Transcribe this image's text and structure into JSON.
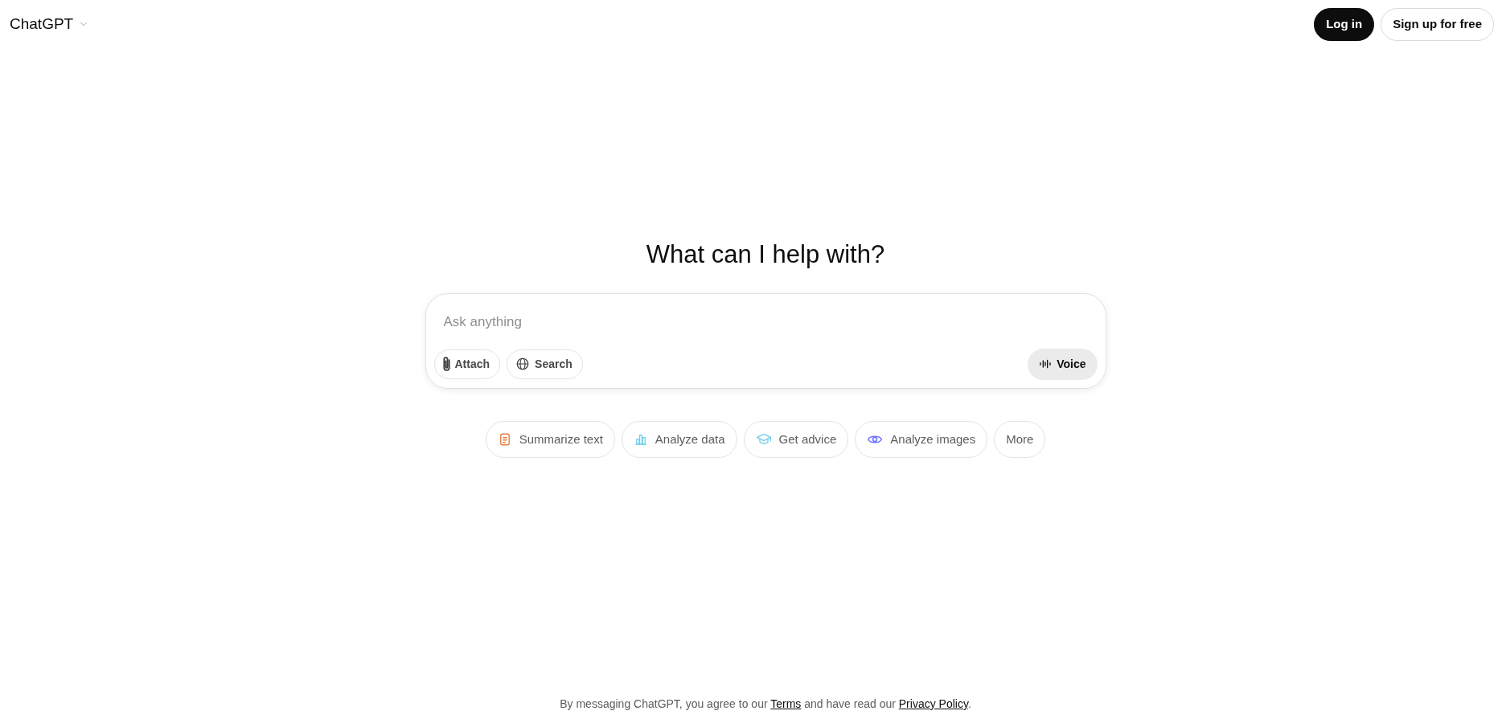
{
  "header": {
    "title": "ChatGPT",
    "buttons": [
      {
        "label": "Log in",
        "kind": "primary"
      },
      {
        "label": "Sign up for free",
        "kind": "outline"
      }
    ]
  },
  "heading": "What can I help with?",
  "composer": {
    "placeholder": "Ask anything",
    "tools": [
      {
        "label": "Attach",
        "kind": "attach"
      },
      {
        "label": "Search",
        "kind": "globe"
      }
    ],
    "voice": {
      "label": "Voice"
    }
  },
  "suggestions": [
    {
      "label": "Summarize text",
      "kind": "document",
      "color": "#e8793e"
    },
    {
      "label": "Analyze data",
      "kind": "chart",
      "color": "#76d0eb"
    },
    {
      "label": "Get advice",
      "kind": "cap",
      "color": "#76d0eb"
    },
    {
      "label": "Analyze images",
      "kind": "eye",
      "color": "#6c71ff"
    },
    {
      "label": "More",
      "kind": "none"
    }
  ],
  "footer": {
    "before": "By messaging ChatGPT, you agree to our ",
    "terms": "Terms",
    "middle": " and have read our ",
    "privacy": "Privacy Policy",
    "after": "."
  }
}
